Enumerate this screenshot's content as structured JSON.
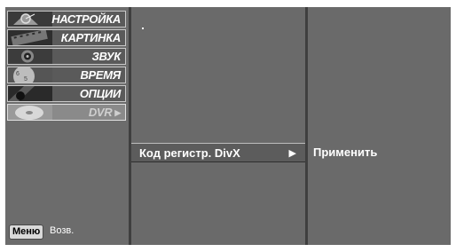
{
  "sidebar": {
    "items": [
      {
        "label": "НАСТРОЙКА",
        "icon": "satellite-dish-icon"
      },
      {
        "label": "КАРТИНКА",
        "icon": "film-strip-icon"
      },
      {
        "label": "ЗВУК",
        "icon": "speaker-icon"
      },
      {
        "label": "ВРЕМЯ",
        "icon": "clock-icon"
      },
      {
        "label": "ОПЦИИ",
        "icon": "special-options-icon"
      },
      {
        "label": "DVR",
        "icon": "disc-icon",
        "selected": true,
        "arrow": "▶"
      }
    ],
    "footer": {
      "key_label": "Меню",
      "back_label": "Возв."
    }
  },
  "submenu": {
    "item_label": "Код регистр. DivX",
    "item_arrow": "▶"
  },
  "detail": {
    "action_label": "Применить"
  },
  "colors": {
    "panel": "#6a6a6a",
    "separator": "#3f3f3f",
    "highlight": "#5c5c5c",
    "text": "#ffffff"
  }
}
